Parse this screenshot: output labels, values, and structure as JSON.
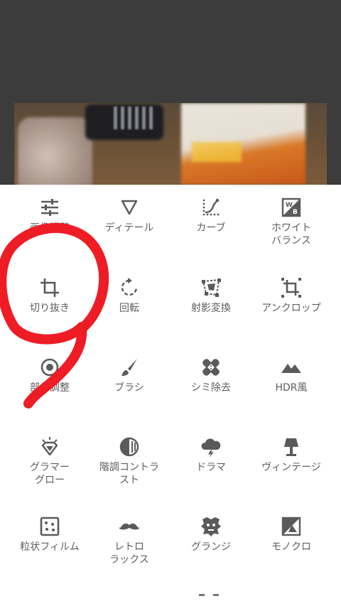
{
  "tools": [
    {
      "label": "画像調整",
      "icon": "tune-sliders-icon"
    },
    {
      "label": "ディテール",
      "icon": "triangle-detail-icon"
    },
    {
      "label": "カーブ",
      "icon": "curves-icon"
    },
    {
      "label": "ホワイト\nバランス",
      "icon": "white-balance-icon"
    },
    {
      "label": "切り抜き",
      "icon": "crop-icon"
    },
    {
      "label": "回転",
      "icon": "rotate-icon"
    },
    {
      "label": "射影変換",
      "icon": "perspective-icon"
    },
    {
      "label": "アンクロップ",
      "icon": "expand-icon"
    },
    {
      "label": "部分調整",
      "icon": "selective-icon"
    },
    {
      "label": "ブラシ",
      "icon": "brush-icon"
    },
    {
      "label": "シミ除去",
      "icon": "healing-icon"
    },
    {
      "label": "HDR風",
      "icon": "hdr-mountains-icon"
    },
    {
      "label": "グラマー\nグロー",
      "icon": "glamour-glow-icon"
    },
    {
      "label": "階調コントラ\nスト",
      "icon": "tonal-contrast-icon"
    },
    {
      "label": "ドラマ",
      "icon": "drama-cloud-icon"
    },
    {
      "label": "ヴィンテージ",
      "icon": "vintage-lamp-icon"
    },
    {
      "label": "粒状フィルム",
      "icon": "grainy-film-icon"
    },
    {
      "label": "レトロ\nラックス",
      "icon": "retrolux-mustache-icon"
    },
    {
      "label": "グランジ",
      "icon": "grunge-icon"
    },
    {
      "label": "モノクロ",
      "icon": "black-and-white-icon"
    }
  ],
  "colors": {
    "preview_bg": "#3c3c3d",
    "icon": "#5a5a5a",
    "annotation": "#ee1c25"
  }
}
